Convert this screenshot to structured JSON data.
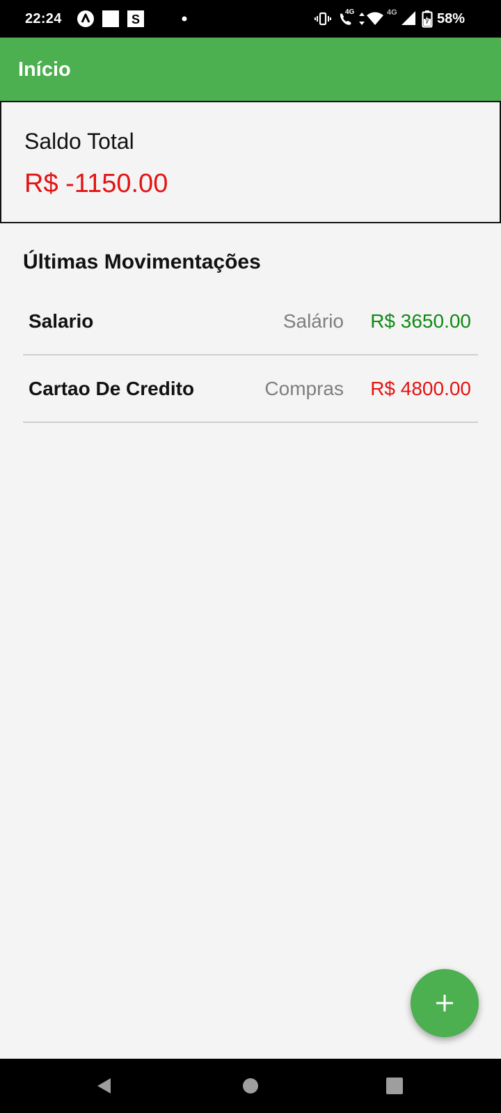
{
  "status_bar": {
    "time": "22:24",
    "notification_icons": [
      "react-native-icon",
      "white-square-icon",
      "s-app-icon",
      "dot-icon"
    ],
    "system_icons": [
      "vibrate-icon",
      "volte-call-icon",
      "wifi-icon",
      "cell-signal-icon",
      "battery-charging-icon"
    ],
    "network_badge_1": "4G",
    "network_badge_2": "4G",
    "battery": "58%"
  },
  "app_bar": {
    "title": "Início",
    "color": "#4caf50"
  },
  "balance": {
    "label": "Saldo Total",
    "value": "R$ -1150.00",
    "value_color": "#e31313"
  },
  "transactions": {
    "title": "Últimas Movimentações",
    "items": [
      {
        "name": "Salario",
        "category": "Salário",
        "amount": "R$ 3650.00",
        "type": "income",
        "color": "#0f8a14"
      },
      {
        "name": "Cartao De Credito",
        "category": "Compras",
        "amount": "R$ 4800.00",
        "type": "expense",
        "color": "#e31313"
      }
    ]
  },
  "fab": {
    "icon": "plus-icon"
  },
  "nav_bar": {
    "icons": [
      "back-icon",
      "home-icon",
      "recents-icon"
    ]
  }
}
